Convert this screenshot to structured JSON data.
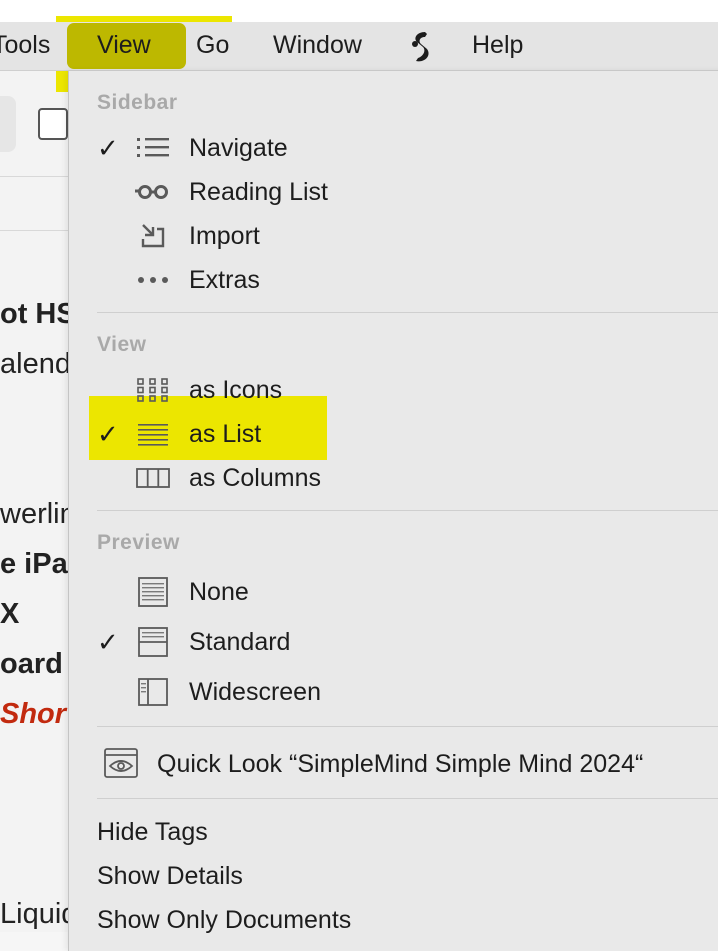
{
  "menubar": {
    "items": [
      "Tools",
      "View",
      "Go",
      "Window",
      "Help"
    ],
    "script_icon": "scriptlet-s-icon"
  },
  "background": {
    "lines": [
      "ot HS",
      "alend",
      "werlin",
      "e iPad",
      "X",
      "oard",
      "Shor",
      "Liquid"
    ]
  },
  "menu": {
    "sidebar": {
      "heading": "Sidebar",
      "items": [
        {
          "label": "Navigate",
          "checked": true,
          "icon": "list-icon"
        },
        {
          "label": "Reading List",
          "checked": false,
          "icon": "glasses-icon"
        },
        {
          "label": "Import",
          "checked": false,
          "icon": "import-icon"
        },
        {
          "label": "Extras",
          "checked": false,
          "icon": "ellipsis-icon"
        }
      ]
    },
    "view": {
      "heading": "View",
      "items": [
        {
          "label": "as Icons",
          "checked": false,
          "icon": "grid-icon"
        },
        {
          "label": "as List",
          "checked": true,
          "icon": "lines-icon"
        },
        {
          "label": "as Columns",
          "checked": false,
          "icon": "columns-icon"
        }
      ]
    },
    "preview": {
      "heading": "Preview",
      "items": [
        {
          "label": "None",
          "checked": false,
          "icon": "preview-none-icon"
        },
        {
          "label": "Standard",
          "checked": true,
          "icon": "preview-standard-icon"
        },
        {
          "label": "Widescreen",
          "checked": false,
          "icon": "preview-widescreen-icon"
        }
      ]
    },
    "quick_look": "Quick Look “SimpleMind Simple Mind 2024“",
    "check_mark": "✓",
    "bottom_items": [
      "Hide Tags",
      "Show Details",
      "Show Only Documents"
    ]
  },
  "colors": {
    "highlight": "#ece600",
    "menu_bg": "#e9e9e9",
    "menubar_bg": "#e4e4e4",
    "section_label": "#a9a9a9",
    "accent_red": "#c22a0f"
  }
}
